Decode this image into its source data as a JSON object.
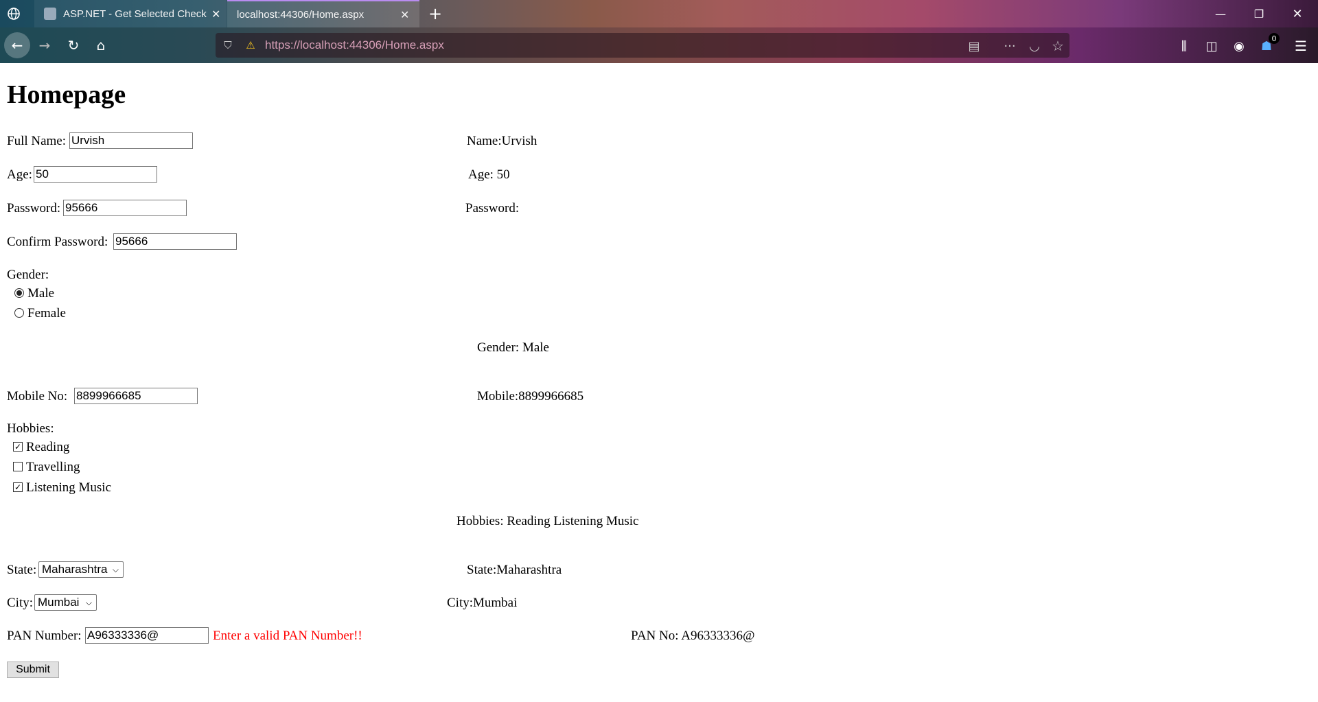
{
  "browser": {
    "tabs": [
      {
        "label": "ASP.NET - Get Selected CheckB"
      },
      {
        "label": "localhost:44306/Home.aspx"
      }
    ],
    "url": "https://localhost:44306/Home.aspx",
    "notification_count": "0"
  },
  "page": {
    "title": "Homepage",
    "form": {
      "full_name_label": "Full Name:",
      "full_name_value": "Urvish",
      "age_label": "Age:",
      "age_value": "50",
      "password_label": "Password:",
      "password_value": "95666",
      "confirm_password_label": "Confirm Password:",
      "confirm_password_value": "95666",
      "gender_label": "Gender:",
      "gender_options": [
        "Male",
        "Female"
      ],
      "gender_selected": "Male",
      "mobile_label": "Mobile No:",
      "mobile_value": "8899966685",
      "hobbies_label": "Hobbies:",
      "hobbies": [
        {
          "label": "Reading",
          "checked": true
        },
        {
          "label": "Travelling",
          "checked": false
        },
        {
          "label": "Listening Music",
          "checked": true
        }
      ],
      "state_label": "State:",
      "state_value": "Maharashtra",
      "city_label": "City:",
      "city_value": "Mumbai",
      "pan_label": "PAN Number:",
      "pan_value": "A96333336@",
      "pan_error": "Enter a valid PAN Number!!",
      "submit_label": "Submit"
    },
    "output": {
      "name": "Name:Urvish",
      "age": "Age: 50",
      "password": "Password:",
      "gender": "Gender: Male",
      "mobile": "Mobile:8899966685",
      "hobbies": "Hobbies: Reading Listening Music",
      "state": "State:Maharashtra",
      "city": "City:Mumbai",
      "pan": "PAN No: A96333336@"
    }
  }
}
